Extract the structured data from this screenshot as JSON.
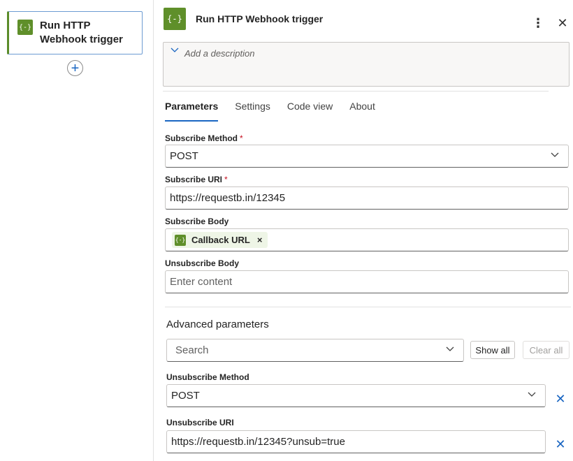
{
  "canvas": {
    "node_title": "Run HTTP Webhook trigger",
    "node_icon": "{-}",
    "add_step_symbol": "+"
  },
  "panel": {
    "title": "Run HTTP Webhook trigger",
    "icon": "{-}",
    "more_symbol": "⋮",
    "close_symbol": "✕",
    "description_placeholder": "Add a description",
    "tabs": [
      {
        "label": "Parameters",
        "active": true
      },
      {
        "label": "Settings",
        "active": false
      },
      {
        "label": "Code view",
        "active": false
      },
      {
        "label": "About",
        "active": false
      }
    ]
  },
  "parameters": {
    "subscribe_method": {
      "label": "Subscribe Method",
      "required": "*",
      "value": "POST"
    },
    "subscribe_uri": {
      "label": "Subscribe URI",
      "required": "*",
      "value": "https://requestb.in/12345"
    },
    "subscribe_body": {
      "label": "Subscribe Body",
      "token_label": "Callback URL",
      "token_icon": "{-}",
      "token_remove": "×"
    },
    "unsubscribe_body": {
      "label": "Unsubscribe Body",
      "placeholder": "Enter content"
    }
  },
  "advanced": {
    "title": "Advanced parameters",
    "search_placeholder": "Search",
    "show_all_label": "Show all",
    "clear_all_label": "Clear all",
    "unsubscribe_method": {
      "label": "Unsubscribe Method",
      "value": "POST"
    },
    "unsubscribe_uri": {
      "label": "Unsubscribe URI",
      "value": "https://requestb.in/12345?unsub=true"
    },
    "remove_symbol": "✕"
  },
  "colors": {
    "accent": "#1a66c2",
    "node_green": "#5f8f2a",
    "required_red": "#c50f1f"
  }
}
